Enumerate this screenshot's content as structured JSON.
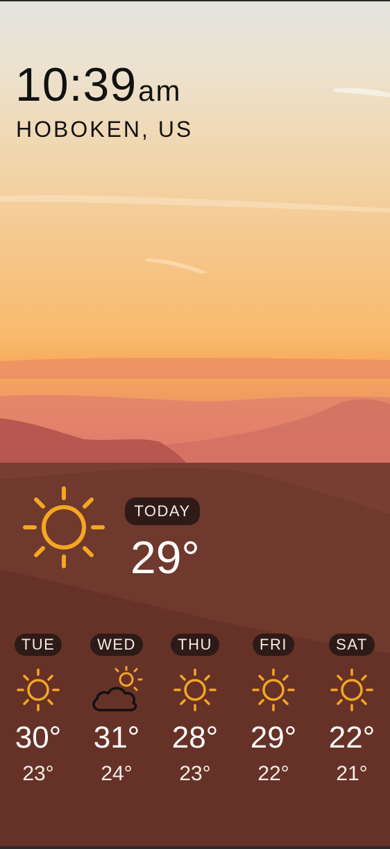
{
  "clock": {
    "time": "10:39",
    "ampm": "am"
  },
  "location": "HOBOKEN, US",
  "today": {
    "label": "TODAY",
    "temp": "29°",
    "icon": "sun-icon"
  },
  "forecast": [
    {
      "day": "TUE",
      "high": "30°",
      "low": "23°",
      "icon": "sun-icon"
    },
    {
      "day": "WED",
      "high": "31°",
      "low": "24°",
      "icon": "partly-cloudy-icon"
    },
    {
      "day": "THU",
      "high": "28°",
      "low": "23°",
      "icon": "sun-icon"
    },
    {
      "day": "FRI",
      "high": "29°",
      "low": "22°",
      "icon": "sun-icon"
    },
    {
      "day": "SAT",
      "high": "22°",
      "low": "21°",
      "icon": "sun-icon"
    }
  ],
  "colors": {
    "sun": "#f5a623",
    "pill_bg": "#2e1b17",
    "panel_overlay": "rgba(74,40,28,0.42)"
  }
}
